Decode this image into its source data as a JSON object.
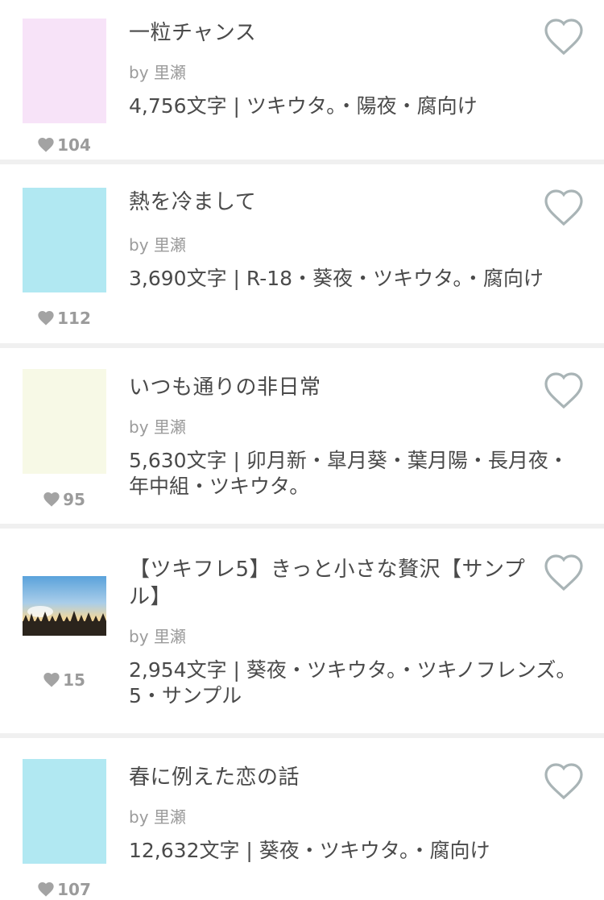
{
  "items": [
    {
      "title": "一粒チャンス",
      "author": "by 里瀬",
      "meta": "4,756文字 | ツキウタ。・陽夜・腐向け",
      "likes": "104",
      "cover_color": "#f7e3f8"
    },
    {
      "title": "熱を冷まして",
      "author": "by 里瀬",
      "meta": "3,690文字 | R-18・葵夜・ツキウタ。・腐向け",
      "likes": "112",
      "cover_color": "#b1e8f2"
    },
    {
      "title": "いつも通りの非日常",
      "author": "by 里瀬",
      "meta": "5,630文字 | 卯月新・皐月葵・葉月陽・長月夜・年中組・ツキウタ。",
      "likes": "95",
      "cover_color": "#f7f9e6"
    },
    {
      "title": "【ツキフレ5】きっと小さな贅沢【サンプル】",
      "author": "by 里瀬",
      "meta": "2,954文字 | 葵夜・ツキウタ。・ツキノフレンズ。5・サンプル",
      "likes": "15",
      "cover_color": "#6aa9d8"
    },
    {
      "title": "春に例えた恋の話",
      "author": "by 里瀬",
      "meta": "12,632文字 | 葵夜・ツキウタ。・腐向け",
      "likes": "107",
      "cover_color": "#b1e8f2"
    }
  ],
  "icons": {
    "like": "heart-icon",
    "favorite": "heart-outline-icon"
  },
  "colors": {
    "heart_fill": "#a3a3a3",
    "heart_outline": "#a9b4b6",
    "separator": "#f0f0f0"
  }
}
